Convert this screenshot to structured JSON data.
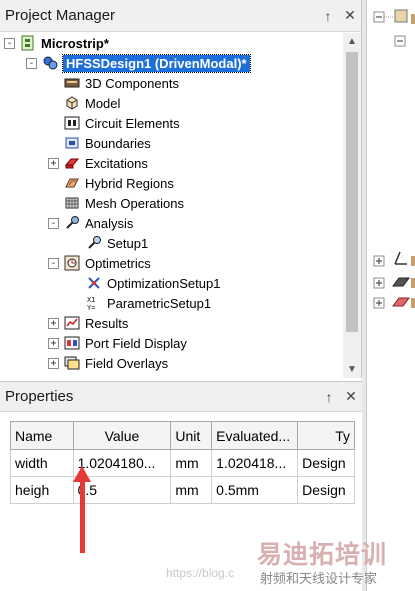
{
  "project_manager": {
    "title": "Project Manager",
    "pin": "↑",
    "close": "✕",
    "tree": [
      {
        "label": "Microstrip*",
        "level": 0,
        "expander": "-",
        "icon": "project-icon",
        "bold": true
      },
      {
        "label": "HFSSDesign1 (DrivenModal)*",
        "level": 1,
        "expander": "-",
        "icon": "design-icon",
        "selected": true
      },
      {
        "label": "3D Components",
        "level": 2,
        "icon": "components-icon"
      },
      {
        "label": "Model",
        "level": 2,
        "icon": "model-icon"
      },
      {
        "label": "Circuit Elements",
        "level": 2,
        "icon": "circuit-icon"
      },
      {
        "label": "Boundaries",
        "level": 2,
        "icon": "boundaries-icon"
      },
      {
        "label": "Excitations",
        "level": 2,
        "expander": "+",
        "icon": "excitations-icon"
      },
      {
        "label": "Hybrid Regions",
        "level": 2,
        "icon": "hybrid-icon"
      },
      {
        "label": "Mesh Operations",
        "level": 2,
        "icon": "mesh-icon"
      },
      {
        "label": "Analysis",
        "level": 2,
        "expander": "-",
        "icon": "analysis-icon"
      },
      {
        "label": "Setup1",
        "level": 3,
        "icon": "setup-icon"
      },
      {
        "label": "Optimetrics",
        "level": 2,
        "expander": "-",
        "icon": "optimetrics-icon"
      },
      {
        "label": "OptimizationSetup1",
        "level": 3,
        "icon": "optimization-icon"
      },
      {
        "label": "ParametricSetup1",
        "level": 3,
        "icon": "parametric-icon"
      },
      {
        "label": "Results",
        "level": 2,
        "expander": "+",
        "icon": "results-icon"
      },
      {
        "label": "Port Field Display",
        "level": 2,
        "expander": "+",
        "icon": "port-field-icon"
      },
      {
        "label": "Field Overlays",
        "level": 2,
        "expander": "+",
        "icon": "field-overlays-icon"
      }
    ]
  },
  "properties": {
    "title": "Properties",
    "pin": "↑",
    "close": "✕",
    "columns": [
      "Name",
      "Value",
      "Unit",
      "Evaluated...",
      "Ty"
    ],
    "rows": [
      [
        "width",
        "1.0204180...",
        "mm",
        "1.020418...",
        "Design"
      ],
      [
        "heigh",
        "0.5",
        "mm",
        "0.5mm",
        "Design"
      ]
    ]
  },
  "watermark": {
    "url": "https://blog.c",
    "brand_cn": "易迪拓培训",
    "brand_sub": "射频和天线设计专家"
  },
  "colors": {
    "selection": "#1e6fd9",
    "arrow": "#e53935"
  }
}
